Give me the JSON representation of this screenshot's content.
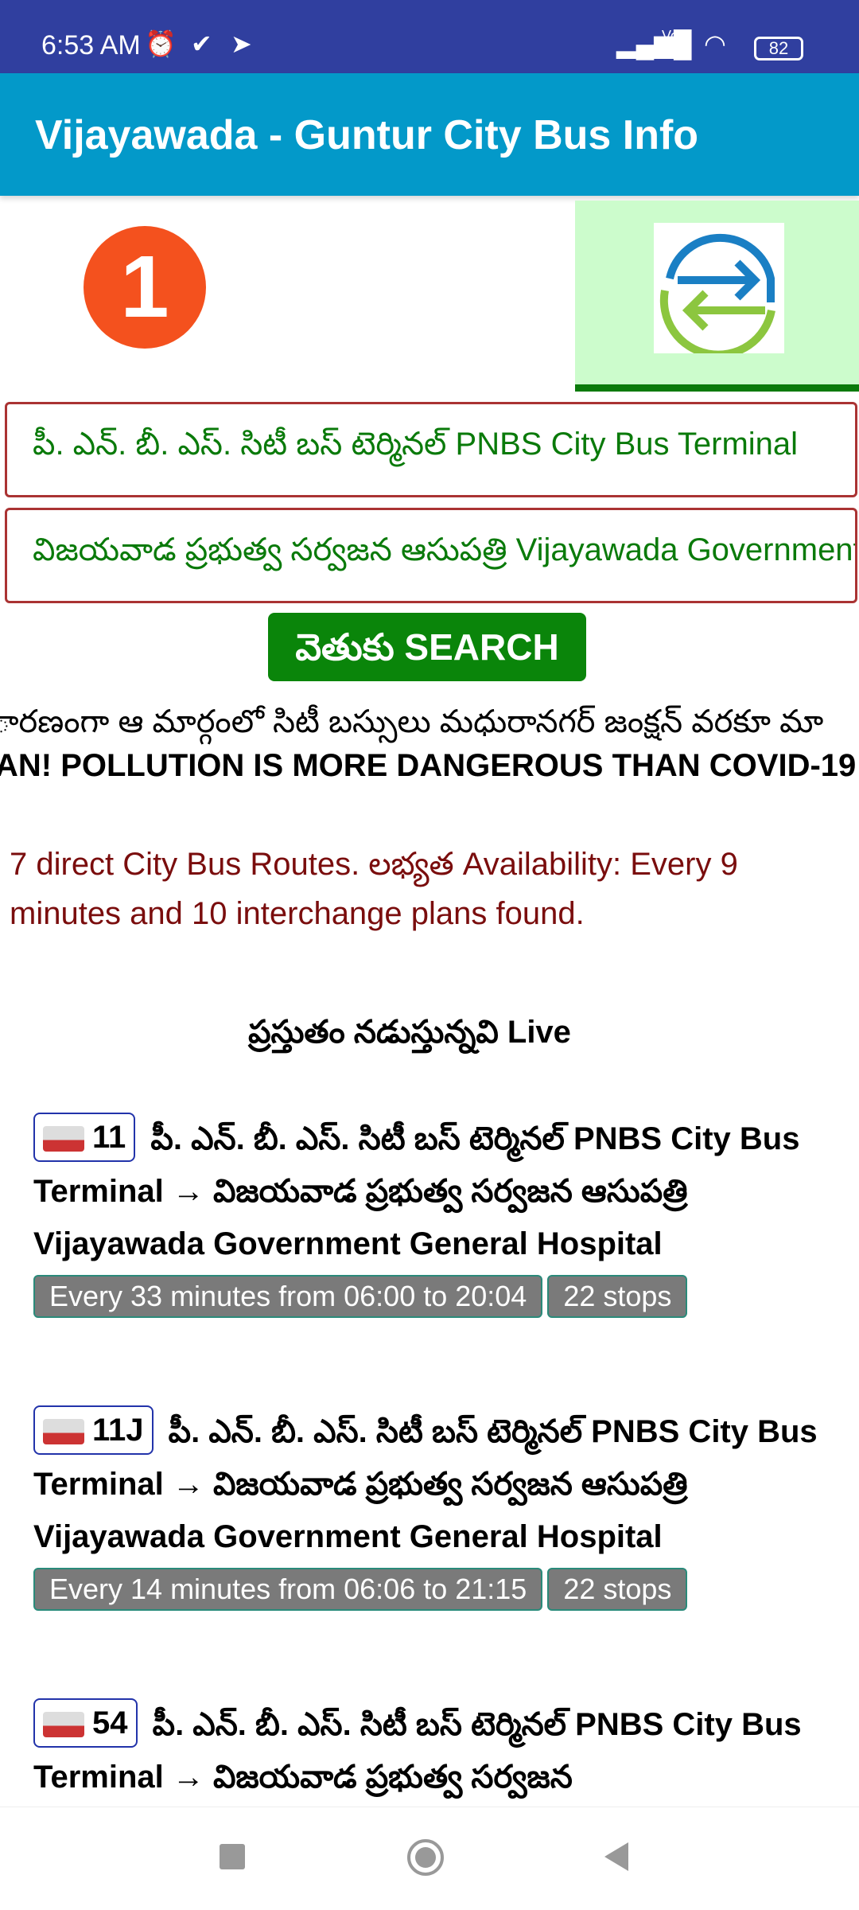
{
  "status_bar": {
    "time": "6:53 AM",
    "battery": "82",
    "network": "Vo WiFi"
  },
  "app_bar": {
    "title": "Vijayawada - Guntur City Bus Info"
  },
  "tabs": [
    {
      "name": "route-number-tab",
      "label": "1"
    },
    {
      "name": "bus-stop-tab"
    },
    {
      "name": "interchange-tab",
      "selected": true
    }
  ],
  "from_field": {
    "value": "పీ. ఎన్. బీ. ఎస్. సిటీ బస్ టెర్మినల్ PNBS City Bus Terminal"
  },
  "to_field": {
    "value": "విజయవాడ ప్రభుత్వ సర్వజన ఆసుపత్రి Vijayawada Government General Hospital"
  },
  "search_label": "వెతుకు SEARCH",
  "marquee": "ారణంగా ఆ మార్గంలో సిటీ బస్సులు మధురానగర్ జంక్షన్ వరకూ మా",
  "pollution": "AN! POLLUTION IS MORE DANGEROUS THAN COVID-19",
  "result_summary": "7 direct City Bus Routes. లభ్యత Availability: Every 9 minutes and 10 interchange plans found.",
  "live_heading": "ప్రస్తుతం నడుస్తున్నవి Live",
  "routes": [
    {
      "number": "11",
      "desc": "పీ. ఎన్. బీ. ఎస్. సిటీ బస్ టెర్మినల్ PNBS City Bus Terminal → విజయవాడ ప్రభుత్వ సర్వజన ఆసుపత్రి Vijayawada Government General Hospital",
      "freq": "Every 33 minutes from 06:00 to 20:04",
      "stops": "22 stops"
    },
    {
      "number": "11J",
      "desc": "పీ. ఎన్. బీ. ఎస్. సిటీ బస్ టెర్మినల్ PNBS City Bus Terminal → విజయవాడ ప్రభుత్వ సర్వజన ఆసుపత్రి Vijayawada Government General Hospital",
      "freq": "Every 14 minutes from 06:06 to 21:15",
      "stops": "22 stops"
    },
    {
      "number": "54",
      "desc": "పీ. ఎన్. బీ. ఎస్. సిటీ బస్ టెర్మినల్ PNBS City Bus Terminal → విజయవాడ ప్రభుత్వ సర్వజన"
    }
  ],
  "colors": {
    "status_bar": "#303f9f",
    "app_bar": "#0399c9",
    "accent_green": "#0a850a",
    "result_text": "#7a0d0d"
  }
}
